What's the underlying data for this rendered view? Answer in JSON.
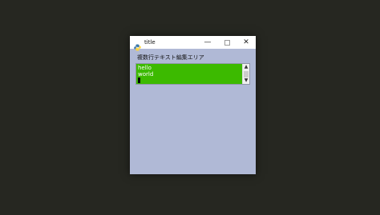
{
  "window": {
    "title": "title",
    "controls": {
      "minimize": "—",
      "close": "✕"
    }
  },
  "main": {
    "label": "複数行テキスト編集エリア",
    "textarea": {
      "lines": [
        "hello",
        "world"
      ],
      "background": "#3cba00",
      "text_color": "#ffffff"
    }
  },
  "scrollbar": {
    "up_arrow": "▲",
    "down_arrow": "▼"
  },
  "colors": {
    "desktop": "#262721",
    "window_bg": "#b0b9d6",
    "titlebar": "#ffffff"
  }
}
